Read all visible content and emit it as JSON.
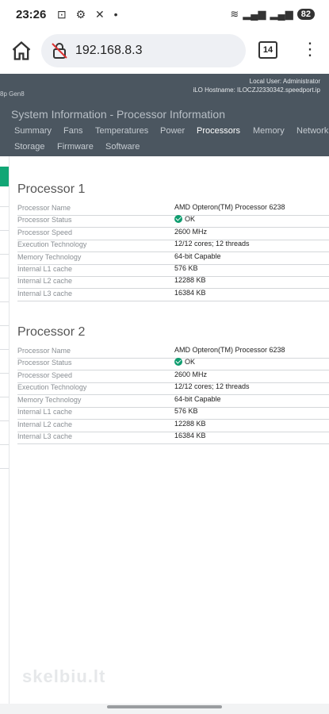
{
  "status_bar": {
    "time": "23:26",
    "battery": "82"
  },
  "browser": {
    "url": "192.168.8.3",
    "tab_count": "14"
  },
  "ilo": {
    "left_label": "8p Gen8",
    "local_user": "Local User: Administrator",
    "hostname": "iLO Hostname: ILOCZJ2330342.speedport.ip",
    "page_title": "System Information - Processor Information",
    "tabs_row1": [
      "Summary",
      "Fans",
      "Temperatures",
      "Power",
      "Processors",
      "Memory",
      "Network"
    ],
    "tabs_row2": [
      "Storage",
      "Firmware",
      "Software"
    ],
    "active_tab": "Processors"
  },
  "processors": [
    {
      "title": "Processor 1",
      "rows": [
        {
          "label": "Processor Name",
          "value": "AMD Opteron(TM) Processor 6238"
        },
        {
          "label": "Processor Status",
          "value": "OK"
        },
        {
          "label": "Processor Speed",
          "value": "2600 MHz"
        },
        {
          "label": "Execution Technology",
          "value": "12/12 cores; 12 threads"
        },
        {
          "label": "Memory Technology",
          "value": "64-bit Capable"
        },
        {
          "label": "Internal L1 cache",
          "value": "576 KB"
        },
        {
          "label": "Internal L2 cache",
          "value": "12288 KB"
        },
        {
          "label": "Internal L3 cache",
          "value": "16384 KB"
        }
      ]
    },
    {
      "title": "Processor 2",
      "rows": [
        {
          "label": "Processor Name",
          "value": "AMD Opteron(TM) Processor 6238"
        },
        {
          "label": "Processor Status",
          "value": "OK"
        },
        {
          "label": "Processor Speed",
          "value": "2600 MHz"
        },
        {
          "label": "Execution Technology",
          "value": "12/12 cores; 12 threads"
        },
        {
          "label": "Memory Technology",
          "value": "64-bit Capable"
        },
        {
          "label": "Internal L1 cache",
          "value": "576 KB"
        },
        {
          "label": "Internal L2 cache",
          "value": "12288 KB"
        },
        {
          "label": "Internal L3 cache",
          "value": "16384 KB"
        }
      ]
    }
  ],
  "watermark": "skelbiu.lt",
  "colors": {
    "header_bg": "#4b5660",
    "ok_green": "#0f9d6f",
    "sidebar_accent": "#11a675"
  }
}
